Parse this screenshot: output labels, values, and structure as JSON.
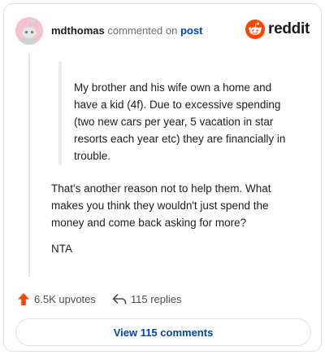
{
  "comment": {
    "username": "mdthomas",
    "action_text": "commented on",
    "post_link": "post",
    "quote": "My brother and his wife own a home and have a kid (4f). Due to excessive spending (two new cars per year, 5 vacation in star resorts each year etc) they are financially in trouble.",
    "body": "That's another reason not to help them. What makes you think they wouldn't just spend the money and come back asking for more?",
    "verdict": "NTA"
  },
  "brand": {
    "name": "reddit",
    "color": "#ff4500"
  },
  "stats": {
    "upvotes": "6.5K upvotes",
    "replies": "115 replies",
    "upvote_color": "#ff4500"
  },
  "footer": {
    "view_comments_label": "View 115 comments"
  },
  "icons": {
    "avatar": "snoo-avatar-icon",
    "logo": "reddit-logo-icon",
    "upvote": "upvote-arrow-icon",
    "reply": "reply-arrow-icon"
  }
}
